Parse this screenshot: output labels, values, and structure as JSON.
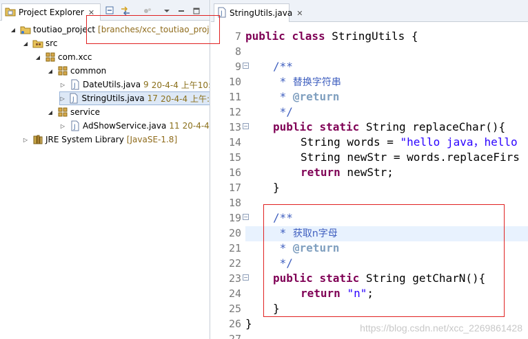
{
  "project_explorer": {
    "tab_title": "Project Explorer",
    "tree": {
      "project": {
        "name": "toutiao_project",
        "decoration": "[branches/xcc_toutiao_proje"
      },
      "src": "src",
      "package": "com.xcc",
      "common": "common",
      "date_utils": {
        "name": "DateUtils.java",
        "rev": "9",
        "date": "20-4-4 上午10:"
      },
      "string_utils": {
        "name": "StringUtils.java",
        "rev": "17",
        "date": "20-4-4 上午:"
      },
      "service": "service",
      "ad_show_service": {
        "name": "AdShowService.java",
        "rev": "11",
        "date": "20-4-4"
      },
      "jre": {
        "name": "JRE System Library",
        "decoration": "[JavaSE-1.8]"
      }
    }
  },
  "editor": {
    "tab_title": "StringUtils.java",
    "line_numbers": [
      "7",
      "8",
      "9",
      "10",
      "11",
      "12",
      "13",
      "14",
      "15",
      "16",
      "17",
      "18",
      "19",
      "20",
      "21",
      "22",
      "23",
      "24",
      "25",
      "26",
      "27"
    ],
    "code": {
      "l7_kw1": "public",
      "l7_kw2": "class",
      "l7_rest": " StringUtils {",
      "l9": "/**",
      "l10_star": " * ",
      "l10_text": "替换字符串",
      "l11_star": " * ",
      "l11_tag": "@return",
      "l12": " */",
      "l13_kw1": "public",
      "l13_kw2": "static",
      "l13_rest": " String replaceChar(){",
      "l14_pre": "String words = ",
      "l14_str": "\"hello java，hello",
      "l15": "String newStr = words.replaceFirs",
      "l16_kw": "return",
      "l16_rest": " newStr;",
      "l17": "}",
      "l19": "/**",
      "l20_star": " * ",
      "l20_text": "获取n字母",
      "l21_star": " * ",
      "l21_tag": "@return",
      "l22": " */",
      "l23_kw1": "public",
      "l23_kw2": "static",
      "l23_rest": " String getCharN(){",
      "l24_kw": "return",
      "l24_str": "\"n\"",
      "l24_rest": ";",
      "l25": "}",
      "l26": "}"
    }
  },
  "watermark": "https://blog.csdn.net/xcc_2269861428",
  "colors": {
    "keyword": "#7f0055",
    "comment": "#3f5fbf",
    "string": "#2a00ff",
    "annotation_box": "#e02020"
  }
}
